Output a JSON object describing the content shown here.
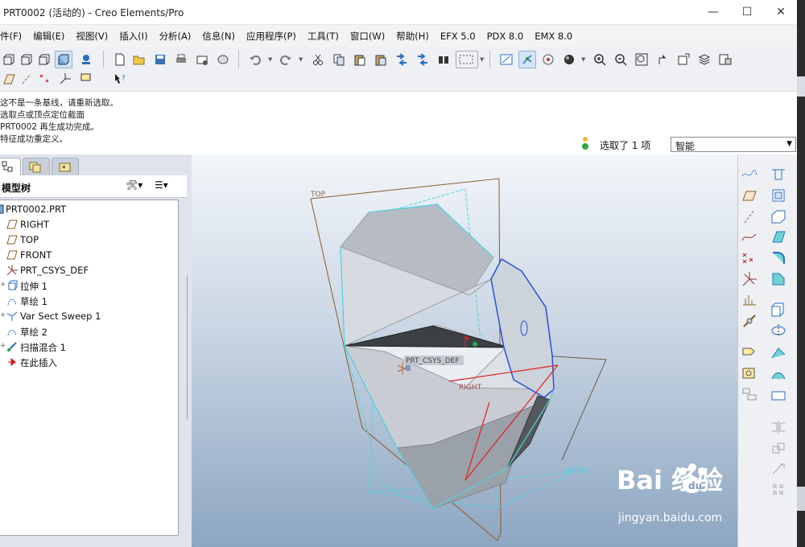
{
  "window": {
    "title": "PRT0002 (活动的) - Creo Elements/Pro",
    "minimize_glyph": "—",
    "maximize_glyph": "☐",
    "close_glyph": "✕"
  },
  "menu": [
    "件(F)",
    "编辑(E)",
    "视图(V)",
    "插入(I)",
    "分析(A)",
    "信息(N)",
    "应用程序(P)",
    "工具(T)",
    "窗口(W)",
    "帮助(H)",
    "EFX 5.0",
    "PDX 8.0",
    "EMX 8.0"
  ],
  "messages": [
    "这不是一条基线，请重新选取。",
    "选取点或顶点定位截面",
    "PRT0002 再生成功完成。",
    "特征成功重定义。"
  ],
  "selection": {
    "text": "选取了 1 项",
    "filter_value": "智能"
  },
  "model_tree": {
    "title": "模型树",
    "items": [
      {
        "label": "PRT0002.PRT",
        "icon": "part-icon"
      },
      {
        "label": "RIGHT",
        "icon": "datum-plane-icon"
      },
      {
        "label": "TOP",
        "icon": "datum-plane-icon"
      },
      {
        "label": "FRONT",
        "icon": "datum-plane-icon"
      },
      {
        "label": "PRT_CSYS_DEF",
        "icon": "csys-icon"
      },
      {
        "label": "拉伸 1",
        "icon": "extrude-icon"
      },
      {
        "label": "草绘 1",
        "icon": "sketch-icon"
      },
      {
        "label": "Var Sect Sweep 1",
        "icon": "var-sweep-icon"
      },
      {
        "label": "草绘 2",
        "icon": "sketch-icon"
      },
      {
        "label": "扫描混合 1",
        "icon": "swept-blend-icon"
      },
      {
        "label": "在此插入",
        "icon": "insert-here-arrow-icon"
      }
    ]
  },
  "viewport": {
    "labels": {
      "top": "TOP",
      "csys": "PRT_CSYS_DEF",
      "right": "RIGHT",
      "front": "FRONT"
    }
  },
  "watermark": {
    "logo": "Bai  经验",
    "url": "jingyan.baidu.com"
  },
  "colors": {
    "accent": "#4d88c9",
    "edge_cyan": "#4fd3e0",
    "datum_brown": "#8b5a2b",
    "selection_red": "#e02020"
  }
}
